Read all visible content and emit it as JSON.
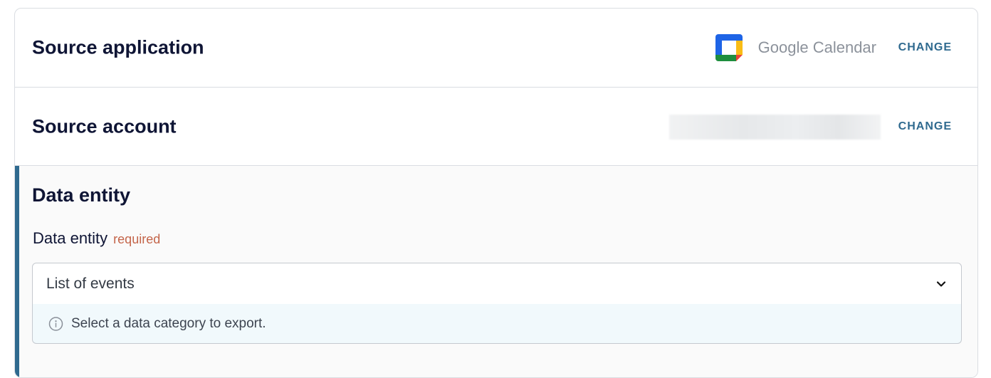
{
  "source_application": {
    "title": "Source application",
    "app_name": "Google Calendar",
    "app_icon": "google-calendar-icon",
    "change_label": "CHANGE"
  },
  "source_account": {
    "title": "Source account",
    "change_label": "CHANGE"
  },
  "data_entity": {
    "heading": "Data entity",
    "field_label": "Data entity",
    "required_label": "required",
    "selected_value": "List of events",
    "hint": "Select a data category to export.",
    "accent_color": "#2f6a8f"
  },
  "colors": {
    "change_link": "#2f6a8f",
    "required": "#c4654a",
    "hint_background": "#f1f9fc"
  }
}
